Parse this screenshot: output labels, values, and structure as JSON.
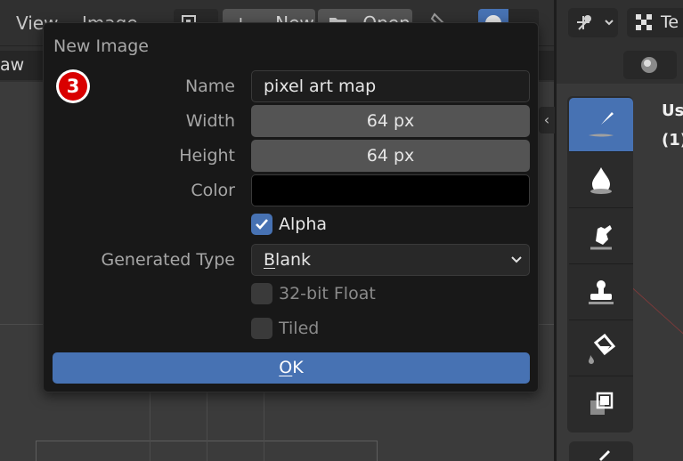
{
  "left_header": {
    "menu": [
      "View",
      "Image"
    ],
    "new_label": "New",
    "open_label": "Open"
  },
  "left_subheader": {
    "label": "aw"
  },
  "right_header": {
    "editor_label": "Te"
  },
  "viewport_overlay": {
    "line1": "Us",
    "line2": "(1)"
  },
  "tools": [
    {
      "name": "draw",
      "icon": "brush-icon",
      "active": true
    },
    {
      "name": "soften",
      "icon": "droplet-icon",
      "active": false
    },
    {
      "name": "smear",
      "icon": "smear-hand-icon",
      "active": false
    },
    {
      "name": "clone",
      "icon": "stamp-icon",
      "active": false
    },
    {
      "name": "fill",
      "icon": "paint-bucket-icon",
      "active": false
    },
    {
      "name": "mask",
      "icon": "mask-icon",
      "active": false
    }
  ],
  "dialog": {
    "title": "New Image",
    "step_badge": "3",
    "name_label": "Name",
    "name_value": "pixel art map",
    "width_label": "Width",
    "width_value": "64 px",
    "height_label": "Height",
    "height_value": "64 px",
    "color_label": "Color",
    "color_value": "#000000",
    "alpha_label": "Alpha",
    "alpha_checked": true,
    "generated_type_label": "Generated Type",
    "generated_type_value_first": "B",
    "generated_type_value_rest": "lank",
    "float_label": "32-bit Float",
    "float_checked": false,
    "tiled_label": "Tiled",
    "tiled_checked": false,
    "ok_first": "O",
    "ok_rest": "K"
  },
  "colors": {
    "accent": "#4772b3",
    "badge_red": "#d90000",
    "dialog_bg": "#181818"
  }
}
